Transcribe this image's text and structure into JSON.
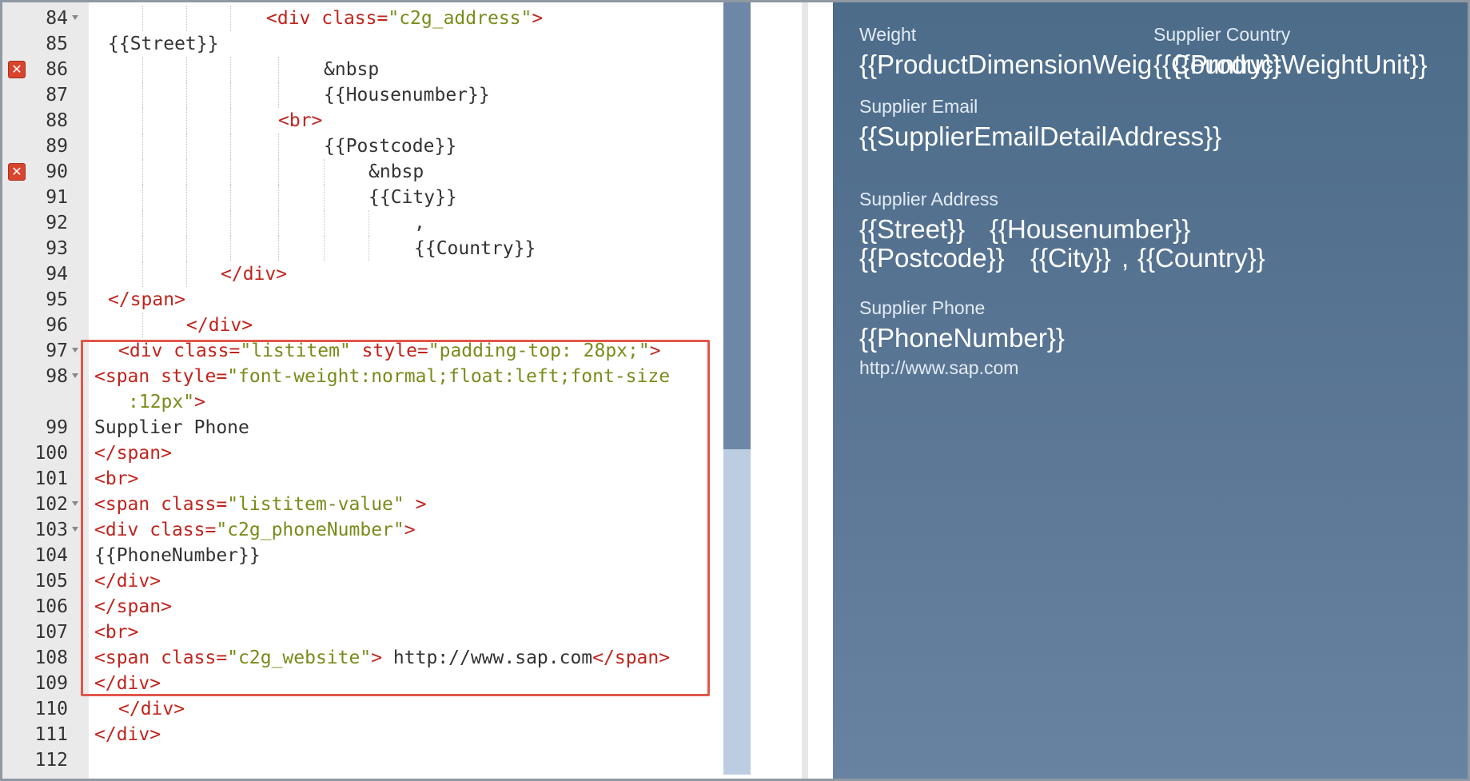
{
  "editor": {
    "lines": [
      {
        "n": "84",
        "fold": true,
        "err": false,
        "indent": 330,
        "guides": [
          175,
          230,
          285
        ],
        "tokens": [
          {
            "c": "tag",
            "t": "<div "
          },
          {
            "c": "attr",
            "t": "class="
          },
          {
            "c": "val",
            "t": "\"c2g_address\""
          },
          {
            "c": "tag",
            "t": ">"
          }
        ]
      },
      {
        "n": "85",
        "fold": false,
        "err": false,
        "indent": 132,
        "guides": [],
        "tokens": [
          {
            "c": "txt",
            "t": "{{Street}}"
          }
        ]
      },
      {
        "n": "86",
        "fold": false,
        "err": true,
        "indent": 402,
        "guides": [
          175,
          230,
          285,
          345
        ],
        "tokens": [
          {
            "c": "txt",
            "t": "&nbsp"
          }
        ]
      },
      {
        "n": "87",
        "fold": false,
        "err": false,
        "indent": 402,
        "guides": [
          175,
          230,
          285,
          345
        ],
        "tokens": [
          {
            "c": "txt",
            "t": "{{Housenumber}}"
          }
        ]
      },
      {
        "n": "88",
        "fold": false,
        "err": false,
        "indent": 345,
        "guides": [
          175,
          230,
          285
        ],
        "tokens": [
          {
            "c": "tag",
            "t": "<br>"
          }
        ]
      },
      {
        "n": "89",
        "fold": false,
        "err": false,
        "indent": 402,
        "guides": [
          175,
          230,
          285,
          345
        ],
        "tokens": [
          {
            "c": "txt",
            "t": "{{Postcode}}"
          }
        ]
      },
      {
        "n": "90",
        "fold": false,
        "err": true,
        "indent": 458,
        "guides": [
          175,
          230,
          285,
          345,
          402
        ],
        "tokens": [
          {
            "c": "txt",
            "t": "&nbsp"
          }
        ]
      },
      {
        "n": "91",
        "fold": false,
        "err": false,
        "indent": 458,
        "guides": [
          175,
          230,
          285,
          345,
          402
        ],
        "tokens": [
          {
            "c": "txt",
            "t": "{{City}}"
          }
        ]
      },
      {
        "n": "92",
        "fold": false,
        "err": false,
        "indent": 515,
        "guides": [
          175,
          230,
          285,
          345,
          402,
          458
        ],
        "tokens": [
          {
            "c": "txt",
            "t": ","
          }
        ]
      },
      {
        "n": "93",
        "fold": false,
        "err": false,
        "indent": 515,
        "guides": [
          175,
          230,
          285,
          345,
          402,
          458
        ],
        "tokens": [
          {
            "c": "txt",
            "t": "{{Country}}"
          }
        ]
      },
      {
        "n": "94",
        "fold": false,
        "err": false,
        "indent": 273,
        "guides": [
          175,
          230
        ],
        "tokens": [
          {
            "c": "tag",
            "t": "</div>"
          }
        ]
      },
      {
        "n": "95",
        "fold": false,
        "err": false,
        "indent": 132,
        "guides": [],
        "tokens": [
          {
            "c": "tag",
            "t": "</span>"
          }
        ]
      },
      {
        "n": "96",
        "fold": false,
        "err": false,
        "indent": 230,
        "guides": [
          175
        ],
        "tokens": [
          {
            "c": "tag",
            "t": "</div>"
          }
        ]
      },
      {
        "n": "97",
        "fold": true,
        "err": false,
        "indent": 145,
        "guides": [],
        "tokens": [
          {
            "c": "tag",
            "t": "<div "
          },
          {
            "c": "attr",
            "t": "class="
          },
          {
            "c": "val",
            "t": "\"listitem\""
          },
          {
            "c": "attr",
            "t": " style="
          },
          {
            "c": "val",
            "t": "\"padding-top: 28px;\""
          },
          {
            "c": "tag",
            "t": ">"
          }
        ]
      },
      {
        "n": "98",
        "fold": true,
        "err": false,
        "indent": 115,
        "guides": [],
        "tokens": [
          {
            "c": "tag",
            "t": "<span "
          },
          {
            "c": "attr",
            "t": "style="
          },
          {
            "c": "val",
            "t": "\"font-weight:normal;float:left;font-size"
          }
        ]
      },
      {
        "n": "",
        "fold": false,
        "err": false,
        "indent": 157,
        "guides": [],
        "tokens": [
          {
            "c": "val",
            "t": ":12px\""
          },
          {
            "c": "tag",
            "t": ">"
          }
        ]
      },
      {
        "n": "99",
        "fold": false,
        "err": false,
        "indent": 115,
        "guides": [],
        "tokens": [
          {
            "c": "txt",
            "t": "Supplier Phone"
          }
        ]
      },
      {
        "n": "100",
        "fold": false,
        "err": false,
        "indent": 115,
        "guides": [],
        "tokens": [
          {
            "c": "tag",
            "t": "</span>"
          }
        ]
      },
      {
        "n": "101",
        "fold": false,
        "err": false,
        "indent": 115,
        "guides": [],
        "tokens": [
          {
            "c": "tag",
            "t": "<br>"
          }
        ]
      },
      {
        "n": "102",
        "fold": true,
        "err": false,
        "indent": 115,
        "guides": [],
        "tokens": [
          {
            "c": "tag",
            "t": "<span "
          },
          {
            "c": "attr",
            "t": "class="
          },
          {
            "c": "val",
            "t": "\"listitem-value\""
          },
          {
            "c": "tag",
            "t": " >"
          }
        ]
      },
      {
        "n": "103",
        "fold": true,
        "err": false,
        "indent": 115,
        "guides": [],
        "tokens": [
          {
            "c": "tag",
            "t": "<div "
          },
          {
            "c": "attr",
            "t": "class="
          },
          {
            "c": "val",
            "t": "\"c2g_phoneNumber\""
          },
          {
            "c": "tag",
            "t": ">"
          }
        ]
      },
      {
        "n": "104",
        "fold": false,
        "err": false,
        "indent": 115,
        "guides": [],
        "tokens": [
          {
            "c": "txt",
            "t": "{{PhoneNumber}}"
          }
        ]
      },
      {
        "n": "105",
        "fold": false,
        "err": false,
        "indent": 115,
        "guides": [],
        "tokens": [
          {
            "c": "tag",
            "t": "</div>"
          }
        ]
      },
      {
        "n": "106",
        "fold": false,
        "err": false,
        "indent": 115,
        "guides": [],
        "tokens": [
          {
            "c": "tag",
            "t": "</span>"
          }
        ]
      },
      {
        "n": "107",
        "fold": false,
        "err": false,
        "indent": 115,
        "guides": [],
        "tokens": [
          {
            "c": "tag",
            "t": "<br>"
          }
        ]
      },
      {
        "n": "108",
        "fold": false,
        "err": false,
        "indent": 115,
        "guides": [],
        "tokens": [
          {
            "c": "tag",
            "t": "<span "
          },
          {
            "c": "attr",
            "t": "class="
          },
          {
            "c": "val",
            "t": "\"c2g_website\""
          },
          {
            "c": "tag",
            "t": ">"
          },
          {
            "c": "txt",
            "t": " http://www.sap.com"
          },
          {
            "c": "tag",
            "t": "</span>"
          }
        ]
      },
      {
        "n": "109",
        "fold": false,
        "err": false,
        "indent": 115,
        "guides": [],
        "tokens": [
          {
            "c": "tag",
            "t": "</div>"
          }
        ]
      },
      {
        "n": "110",
        "fold": false,
        "err": false,
        "indent": 145,
        "guides": [],
        "tokens": [
          {
            "c": "tag",
            "t": "</div>"
          }
        ]
      },
      {
        "n": "111",
        "fold": false,
        "err": false,
        "indent": 115,
        "guides": [],
        "tokens": [
          {
            "c": "tag",
            "t": "</div>"
          }
        ]
      },
      {
        "n": "112",
        "fold": false,
        "err": false,
        "indent": 115,
        "guides": [],
        "tokens": []
      }
    ]
  },
  "preview": {
    "weight_label": "Weight",
    "weight_value": "{{ProductDimensionWeig",
    "weight_unit": "{{ProductWeightUnit}}",
    "country_label": "Supplier Country",
    "country_value": "{{Country}}",
    "email_label": "Supplier Email",
    "email_value": "{{SupplierEmailDetailAddress}}",
    "address_label": "Supplier Address",
    "street": "{{Street}}",
    "housenumber": "{{Housenumber}}",
    "postcode": "{{Postcode}}",
    "city": "{{City}}",
    "comma": ",",
    "country": "{{Country}}",
    "phone_label": "Supplier Phone",
    "phone_value": "{{PhoneNumber}}",
    "website": "http://www.sap.com"
  },
  "colors": {
    "tag": "#c0241c",
    "attribute_value": "#7a8b1a",
    "highlight_border": "#e1574b",
    "preview_bg": "#5b7795",
    "scrollbar_thumb": "#6e87a6"
  }
}
